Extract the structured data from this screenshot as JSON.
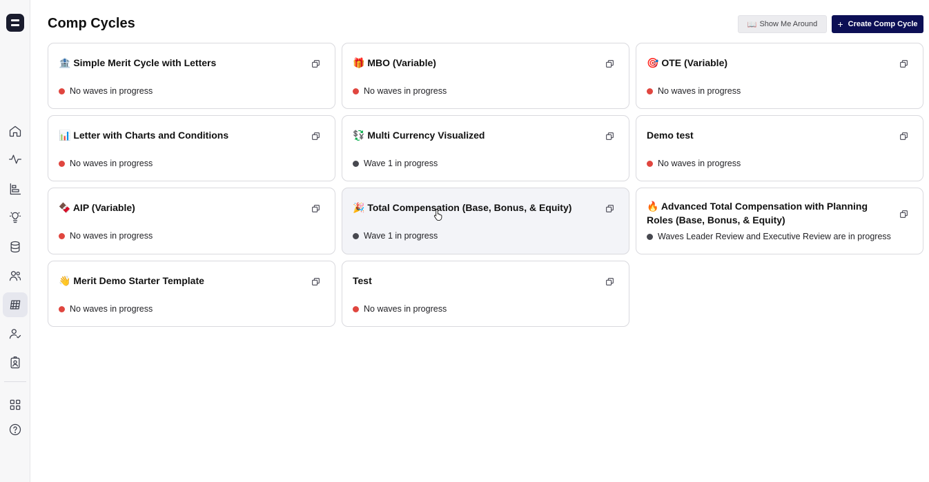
{
  "page": {
    "title": "Comp Cycles",
    "tour_icon": "📖",
    "tour_label": "Show Me Around",
    "create_icon": "+",
    "create_label": "Create Comp Cycle"
  },
  "colors": {
    "no_waves": "#e0463f",
    "in_progress": "#47484f",
    "primary": "#0c0f55"
  },
  "sidebar": {
    "items": [
      {
        "name": "home-icon"
      },
      {
        "name": "activity-icon"
      },
      {
        "name": "bar-chart-icon"
      },
      {
        "name": "lightbulb-icon"
      },
      {
        "name": "database-icon"
      },
      {
        "name": "people-icon"
      },
      {
        "name": "comp-table-icon",
        "active": true
      },
      {
        "name": "user-check-icon"
      },
      {
        "name": "badge-icon"
      },
      {
        "name": "apps-grid-icon"
      },
      {
        "name": "help-icon"
      }
    ]
  },
  "cycles": [
    {
      "emoji": "🏦",
      "name": "Simple Merit Cycle with Letters",
      "status": "No waves in progress",
      "state": "none"
    },
    {
      "emoji": "🎁",
      "name": "MBO (Variable)",
      "status": "No waves in progress",
      "state": "none"
    },
    {
      "emoji": "🎯",
      "name": "OTE (Variable)",
      "status": "No waves in progress",
      "state": "none"
    },
    {
      "emoji": "📊",
      "name": "Letter with Charts and Conditions",
      "status": "No waves in progress",
      "state": "none"
    },
    {
      "emoji": "💱",
      "name": "Multi Currency Visualized",
      "status": "Wave 1 in progress",
      "state": "active"
    },
    {
      "emoji": "",
      "name": "Demo test",
      "status": "No waves in progress",
      "state": "none"
    },
    {
      "emoji": "🍫",
      "name": "AIP (Variable)",
      "status": "No waves in progress",
      "state": "none"
    },
    {
      "emoji": "🎉",
      "name": "Total Compensation (Base, Bonus, & Equity)",
      "status": "Wave 1 in progress",
      "state": "active",
      "hover": true
    },
    {
      "emoji": "🔥",
      "name": "Advanced Total Compensation with Planning Roles (Base, Bonus, & Equity)",
      "status": "Waves Leader Review and Executive Review are in progress",
      "state": "active",
      "two_line": true
    },
    {
      "emoji": "👋",
      "name": "Merit Demo Starter Template",
      "status": "No waves in progress",
      "state": "none"
    },
    {
      "emoji": "",
      "name": "Test",
      "status": "No waves in progress",
      "state": "none"
    }
  ]
}
